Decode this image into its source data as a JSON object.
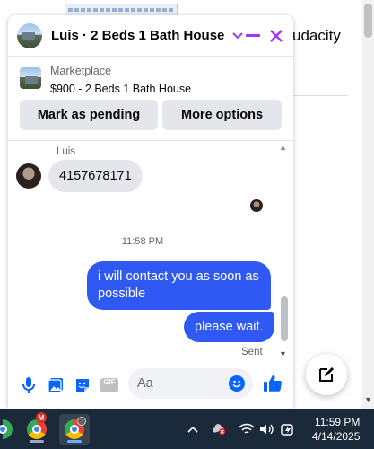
{
  "background": {
    "partial_text": "udacity"
  },
  "chat": {
    "title": "Luis · 2 Beds 1 Bath House",
    "listing": {
      "source_label": "Marketplace",
      "price_title": "$900 - 2 Beds 1 Bath House"
    },
    "actions": {
      "mark_pending": "Mark as pending",
      "more_options": "More options"
    },
    "messages": {
      "sender_name": "Luis",
      "incoming_text": "4157678171",
      "time_separator": "11:58 PM",
      "outgoing": [
        "i will contact you as soon as possible",
        "please wait."
      ],
      "status": "Sent"
    },
    "composer": {
      "placeholder": "Aa",
      "gif_label": "GIF"
    }
  },
  "taskbar": {
    "time": "11:59 PM",
    "date": "4/14/2025",
    "badge_letter": "M"
  },
  "colors": {
    "accent": "#0866ff",
    "close": "#a033ff",
    "bubble_out": "#2f59f2",
    "bubble_in": "#e4e6eb"
  }
}
